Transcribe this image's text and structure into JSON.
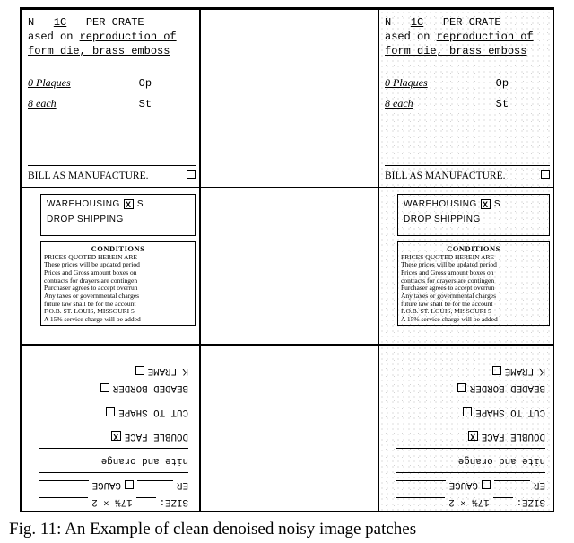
{
  "crate": {
    "l1_a": "N   ",
    "l1_b": "1C",
    "l1_c": "   PER CRATE",
    "l2": "ased on ",
    "l2_u": "reproduction of",
    "l3_u": "form die, brass emboss",
    "l4_a": "0 Plaques",
    "l4_b": "Op",
    "l5_a": "8 each",
    "l5_b": "St",
    "bill": "BILL AS MANUFACTURE."
  },
  "ware": {
    "warehousing": "WAREHOUSING",
    "x": "X",
    "s": "S",
    "drop": "DROP SHIPPING"
  },
  "cond": {
    "hd": "CONDITIONS",
    "l1": "PRICES QUOTED HEREIN ARE",
    "l2": "These prices will be updated period",
    "l3": "Prices and Gross amount boxes on",
    "l4": "contracts for drayers are contingen",
    "l5": "Purchaser agrees to accept overrun",
    "l6": "Any taxes or governmental charges",
    "l7": "future law shall be for the account",
    "l8": "F.O.B. ST. LOUIS, MISSOURI  5",
    "l9": "A 15% service charge will be added"
  },
  "rot": {
    "l1_a": "SIZE:",
    "l1_b": "17¾ × 2",
    "l2_a": "ER",
    "l2_b": "GAUGE",
    "l3": "hite and orange",
    "l4": "DOUBLE FACE",
    "l4_x": "X",
    "l5": "CUT TO SHAPE",
    "l6": "BEADED BORDER",
    "l7": "K FRAME"
  },
  "caption": "Fig. 11: An Example of clean denoised noisy image patches"
}
